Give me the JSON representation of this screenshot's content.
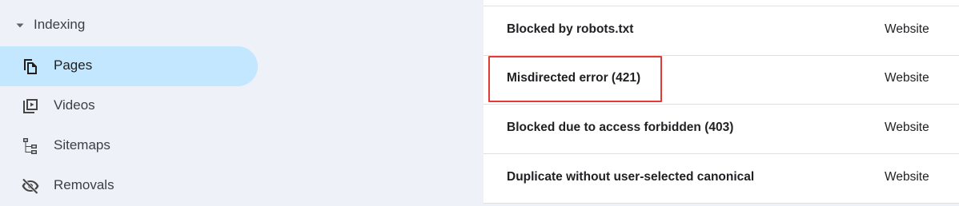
{
  "sidebar": {
    "section": {
      "title": "Indexing",
      "icon": "caret-down-icon"
    },
    "items": [
      {
        "label": "Pages",
        "icon": "pages-icon",
        "active": true
      },
      {
        "label": "Videos",
        "icon": "video-icon",
        "active": false
      },
      {
        "label": "Sitemaps",
        "icon": "sitemap-icon",
        "active": false
      },
      {
        "label": "Removals",
        "icon": "eye-off-icon",
        "active": false
      }
    ]
  },
  "table": {
    "rows": [
      {
        "reason": "Blocked by robots.txt",
        "source": "Website"
      },
      {
        "reason": "Misdirected error (421)",
        "source": "Website",
        "highlighted": true
      },
      {
        "reason": "Blocked due to access forbidden (403)",
        "source": "Website"
      },
      {
        "reason": "Duplicate without user-selected canonical",
        "source": "Website"
      }
    ]
  },
  "colors": {
    "active_nav_bg": "#c2e7ff",
    "sidebar_bg": "#eef1f8",
    "highlight": "#e53935"
  }
}
